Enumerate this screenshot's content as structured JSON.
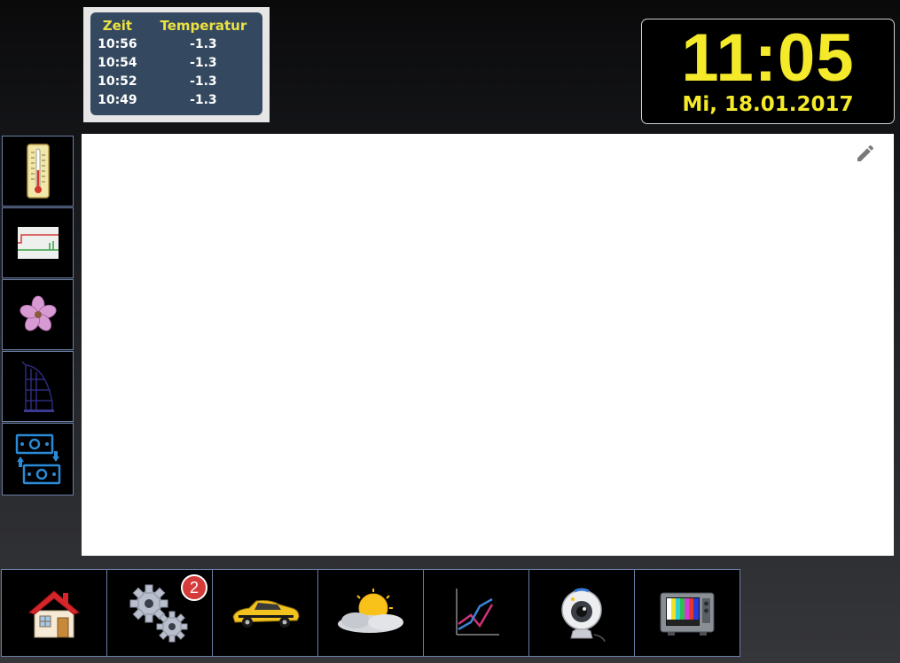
{
  "temperature_widget": {
    "headers": [
      "Zeit",
      "Temperatur"
    ],
    "rows": [
      {
        "time": "10:56",
        "value": "-1.3"
      },
      {
        "time": "10:54",
        "value": "-1.3"
      },
      {
        "time": "10:52",
        "value": "-1.3"
      },
      {
        "time": "10:49",
        "value": "-1.3"
      }
    ]
  },
  "clock": {
    "time": "11:05",
    "date": "Mi, 18.01.2017"
  },
  "sidebar": {
    "items": [
      {
        "icon": "thermometer-icon"
      },
      {
        "icon": "graph-panel-icon"
      },
      {
        "icon": "flower-icon"
      },
      {
        "icon": "homematic-tower-icon"
      },
      {
        "icon": "money-exchange-icon"
      }
    ]
  },
  "bottom_bar": {
    "items": [
      {
        "icon": "home-icon"
      },
      {
        "icon": "gears-icon",
        "badge": "2"
      },
      {
        "icon": "car-icon"
      },
      {
        "icon": "weather-icon"
      },
      {
        "icon": "chart-icon"
      },
      {
        "icon": "webcam-icon"
      },
      {
        "icon": "tv-icon"
      }
    ]
  },
  "colors": {
    "accent_yellow": "#f4ea2a",
    "widget_blue": "#34495f",
    "badge_red": "#d53b3b",
    "border_blue": "#6b7fa6"
  }
}
